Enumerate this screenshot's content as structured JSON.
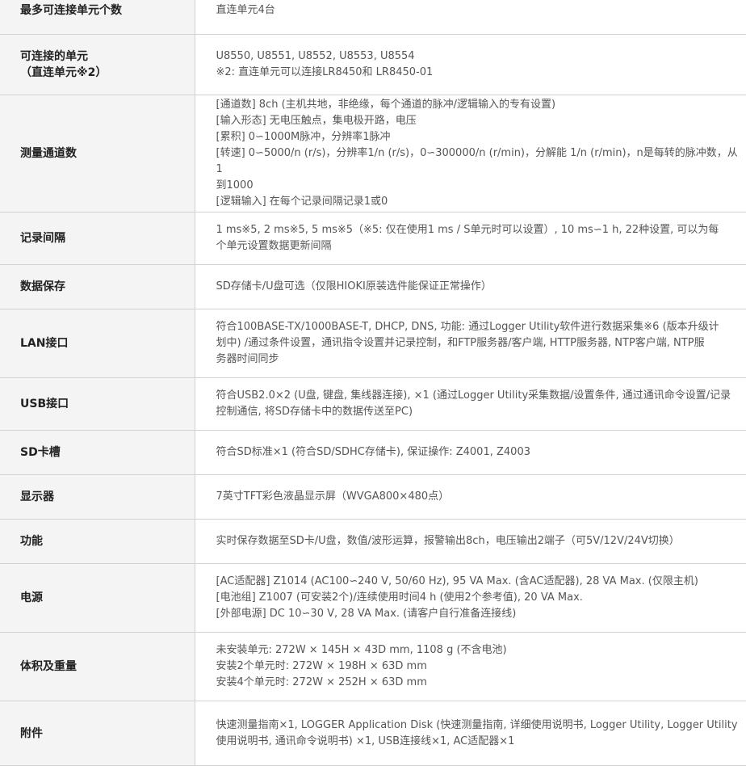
{
  "spec_rows": [
    {
      "label": [
        "最多可连接单元个数"
      ],
      "lines": [
        "直连单元4台"
      ]
    },
    {
      "label": [
        "可连接的单元",
        "（直连单元※2）"
      ],
      "lines": [
        "U8550, U8551, U8552, U8553, U8554",
        "※2: 直连单元可以连接LR8450和 LR8450-01"
      ]
    },
    {
      "label": [
        "测量通道数"
      ],
      "lines": [
        "[通道数] 8ch (主机共地，非绝缘，每个通道的脉冲/逻辑输入的专有设置)",
        "[输入形态] 无电压触点，集电极开路，电压",
        "[累积] 0∽1000M脉冲，分辨率1脉冲",
        "[转速] 0∽5000/n (r/s)，分辨率1/n (r/s)，0∽300000/n (r/min)，分解能 1/n (r/min)，n是每转的脉冲数，从1",
        "到1000",
        "[逻辑输入] 在每个记录间隔记录1或0"
      ]
    },
    {
      "label": [
        "记录间隔"
      ],
      "lines": [
        "1 ms※5, 2 ms※5, 5 ms※5（※5: 仅在使用1 ms / S单元时可以设置）, 10 ms∽1 h, 22种设置, 可以为每",
        "个单元设置数据更新间隔"
      ]
    },
    {
      "label": [
        "数据保存"
      ],
      "lines": [
        "SD存储卡/U盘可选（仅限HIOKI原装选件能保证正常操作）"
      ]
    },
    {
      "label": [
        "LAN接口"
      ],
      "lines": [
        "符合100BASE-TX/1000BASE-T, DHCP, DNS, 功能: 通过Logger Utility软件进行数据采集※6 (版本升级计",
        "划中) /通过条件设置，通讯指令设置并记录控制，和FTP服务器/客户端, HTTP服务器, NTP客户端, NTP服",
        "务器时间同步"
      ]
    },
    {
      "label": [
        "USB接口"
      ],
      "lines": [
        "符合USB2.0×2 (U盘, 键盘, 集线器连接), ×1 (通过Logger Utility采集数据/设置条件, 通过通讯命令设置/记录",
        "控制通信, 将SD存储卡中的数据传送至PC)"
      ]
    },
    {
      "label": [
        "SD卡槽"
      ],
      "lines": [
        "符合SD标准×1 (符合SD/SDHC存储卡), 保证操作: Z4001, Z4003"
      ]
    },
    {
      "label": [
        "显示器"
      ],
      "lines": [
        "7英寸TFT彩色液晶显示屏（WVGA800×480点）"
      ]
    },
    {
      "label": [
        "功能"
      ],
      "lines": [
        "实时保存数据至SD卡/U盘，数值/波形运算，报警输出8ch，电压输出2端子（可5V/12V/24V切换）"
      ]
    },
    {
      "label": [
        "电源"
      ],
      "lines": [
        "[AC适配器] Z1014 (AC100∽240 V, 50/60 Hz), 95 VA Max. (含AC适配器), 28 VA Max. (仅限主机)",
        "[电池组] Z1007 (可安装2个)/连续使用时间4 h (使用2个参考值), 20 VA Max.",
        "[外部电源] DC 10∽30 V, 28 VA Max. (请客户自行准备连接线)"
      ]
    },
    {
      "label": [
        "体积及重量"
      ],
      "lines": [
        "未安装单元: 272W × 145H × 43D mm, 1108 g (不含电池)",
        "安装2个单元时: 272W × 198H × 63D mm",
        "安装4个单元时: 272W × 252H × 63D mm"
      ]
    },
    {
      "label": [
        "附件"
      ],
      "lines": [
        "快速测量指南×1, LOGGER Application Disk (快速测量指南, 详细使用说明书, Logger Utility, Logger Utility",
        "使用说明书, 通讯命令说明书) ×1, USB连接线×1, AC适配器×1"
      ]
    }
  ]
}
